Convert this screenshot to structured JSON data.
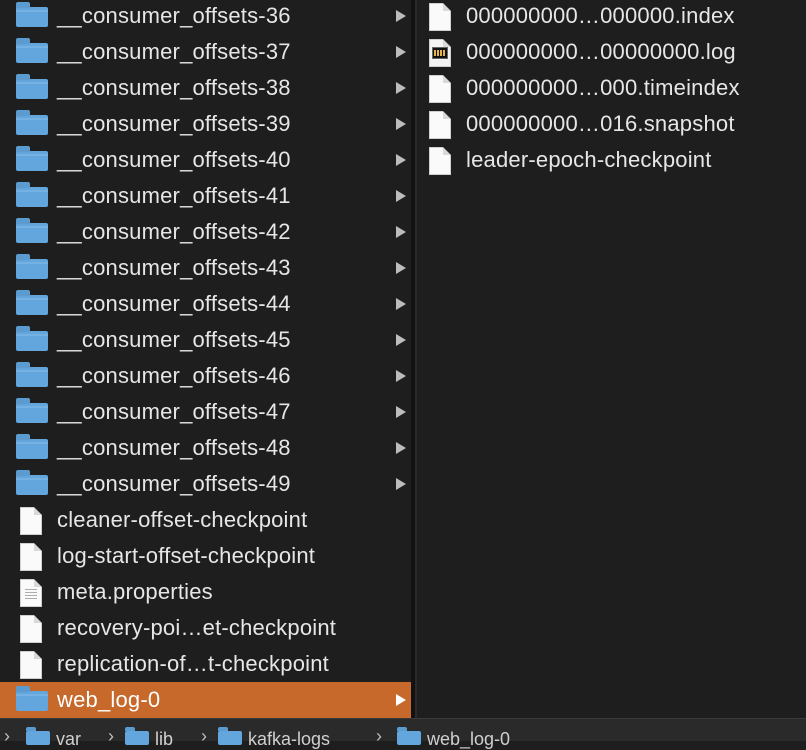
{
  "left_column": {
    "items": [
      {
        "label": "__consumer_offsets-36",
        "icon": "folder-icon",
        "has_children": true,
        "selected": false
      },
      {
        "label": "__consumer_offsets-37",
        "icon": "folder-icon",
        "has_children": true,
        "selected": false
      },
      {
        "label": "__consumer_offsets-38",
        "icon": "folder-icon",
        "has_children": true,
        "selected": false
      },
      {
        "label": "__consumer_offsets-39",
        "icon": "folder-icon",
        "has_children": true,
        "selected": false
      },
      {
        "label": "__consumer_offsets-40",
        "icon": "folder-icon",
        "has_children": true,
        "selected": false
      },
      {
        "label": "__consumer_offsets-41",
        "icon": "folder-icon",
        "has_children": true,
        "selected": false
      },
      {
        "label": "__consumer_offsets-42",
        "icon": "folder-icon",
        "has_children": true,
        "selected": false
      },
      {
        "label": "__consumer_offsets-43",
        "icon": "folder-icon",
        "has_children": true,
        "selected": false
      },
      {
        "label": "__consumer_offsets-44",
        "icon": "folder-icon",
        "has_children": true,
        "selected": false
      },
      {
        "label": "__consumer_offsets-45",
        "icon": "folder-icon",
        "has_children": true,
        "selected": false
      },
      {
        "label": "__consumer_offsets-46",
        "icon": "folder-icon",
        "has_children": true,
        "selected": false
      },
      {
        "label": "__consumer_offsets-47",
        "icon": "folder-icon",
        "has_children": true,
        "selected": false
      },
      {
        "label": "__consumer_offsets-48",
        "icon": "folder-icon",
        "has_children": true,
        "selected": false
      },
      {
        "label": "__consumer_offsets-49",
        "icon": "folder-icon",
        "has_children": true,
        "selected": false
      },
      {
        "label": "cleaner-offset-checkpoint",
        "icon": "document-icon",
        "has_children": false,
        "selected": false
      },
      {
        "label": "log-start-offset-checkpoint",
        "icon": "document-icon",
        "has_children": false,
        "selected": false
      },
      {
        "label": "meta.properties",
        "icon": "properties-document-icon",
        "has_children": false,
        "selected": false
      },
      {
        "label": "recovery-poi…et-checkpoint",
        "icon": "document-icon",
        "has_children": false,
        "selected": false
      },
      {
        "label": "replication-of…t-checkpoint",
        "icon": "document-icon",
        "has_children": false,
        "selected": false
      },
      {
        "label": "web_log-0",
        "icon": "folder-icon",
        "has_children": true,
        "selected": true
      }
    ]
  },
  "right_column": {
    "items": [
      {
        "label": "000000000…000000.index",
        "icon": "document-icon"
      },
      {
        "label": "000000000…00000000.log",
        "icon": "log-file-icon"
      },
      {
        "label": "000000000…000.timeindex",
        "icon": "document-icon"
      },
      {
        "label": "000000000…016.snapshot",
        "icon": "document-icon"
      },
      {
        "label": "leader-epoch-checkpoint",
        "icon": "document-icon"
      }
    ]
  },
  "path_bar": {
    "crumbs": [
      {
        "label": "var",
        "icon": "folder-icon"
      },
      {
        "label": "lib",
        "icon": "folder-icon"
      },
      {
        "label": "kafka-logs",
        "icon": "folder-icon"
      },
      {
        "label": "web_log-0",
        "icon": "folder-icon"
      }
    ],
    "separator": "›"
  },
  "colors": {
    "background": "#1e1e1e",
    "selection": "#c6692a",
    "folder": "#63a6dd",
    "text": "#e6e6e6"
  }
}
